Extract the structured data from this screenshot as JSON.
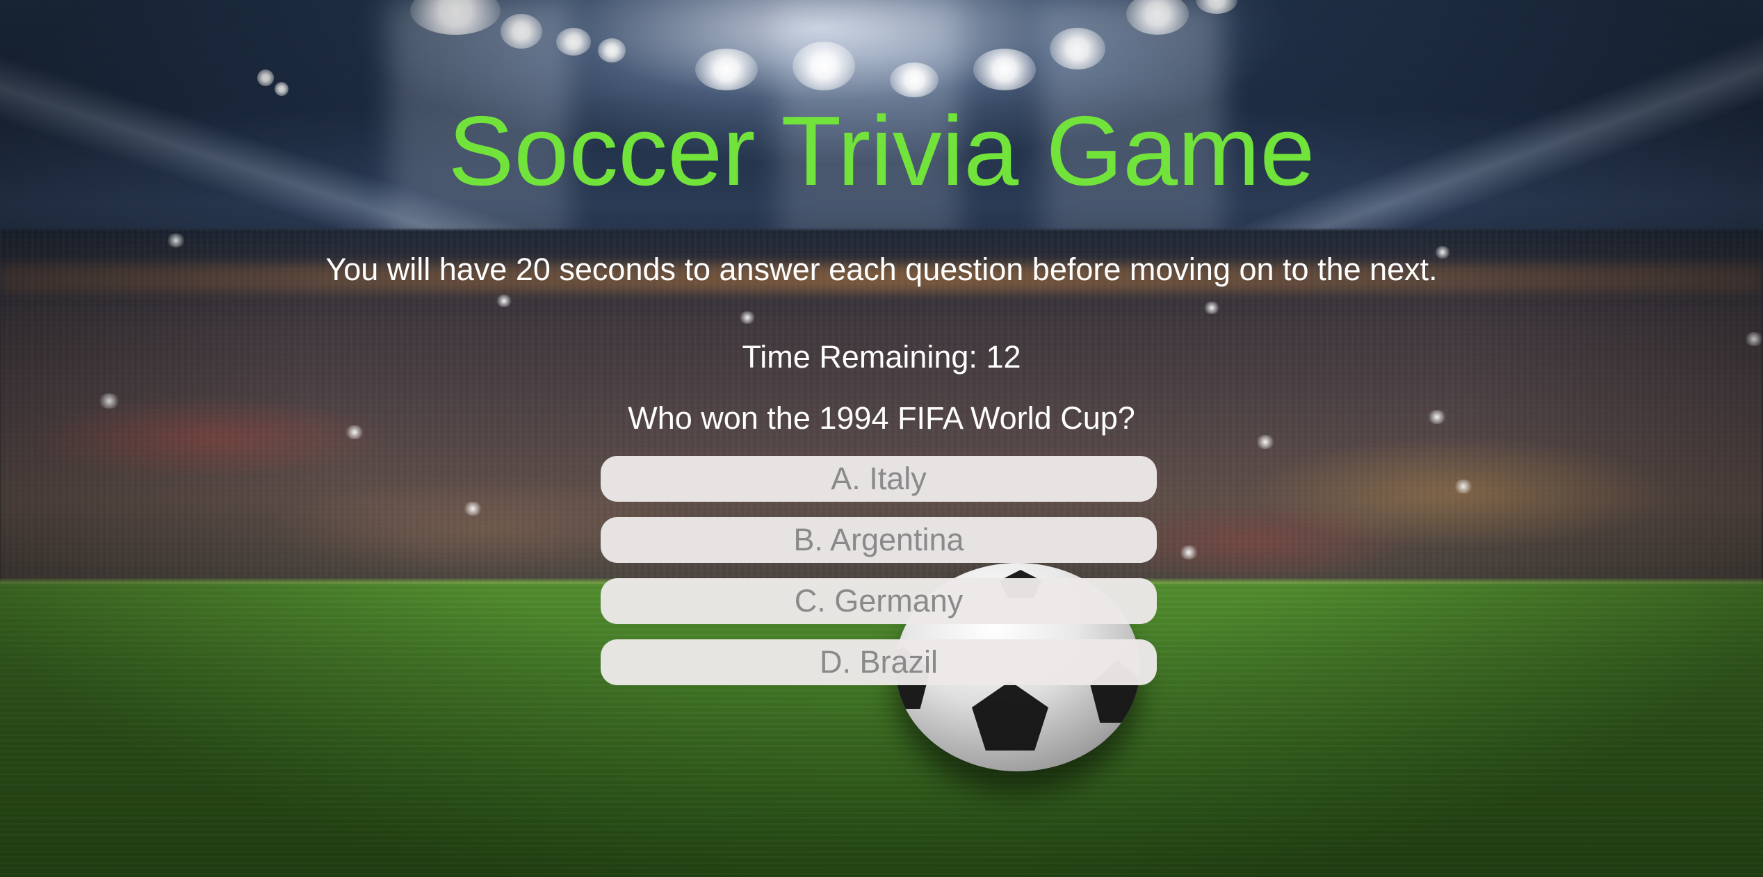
{
  "game": {
    "title": "Soccer Trivia Game",
    "instructions": "You will have 20 seconds to answer each question before moving on to the next.",
    "timer_label": "Time Remaining:",
    "time_remaining": "12",
    "question": "Who won the 1994 FIFA World Cup?",
    "answers": [
      {
        "label": "A. Italy"
      },
      {
        "label": "B. Argentina"
      },
      {
        "label": "C. Germany"
      },
      {
        "label": "D. Brazil"
      }
    ]
  },
  "colors": {
    "title": "#71e33a",
    "text": "#ffffff",
    "answer_bg": "#ece8e8",
    "answer_text": "#8a8a8a"
  },
  "background": {
    "scene": "stadium-with-soccer-ball"
  }
}
